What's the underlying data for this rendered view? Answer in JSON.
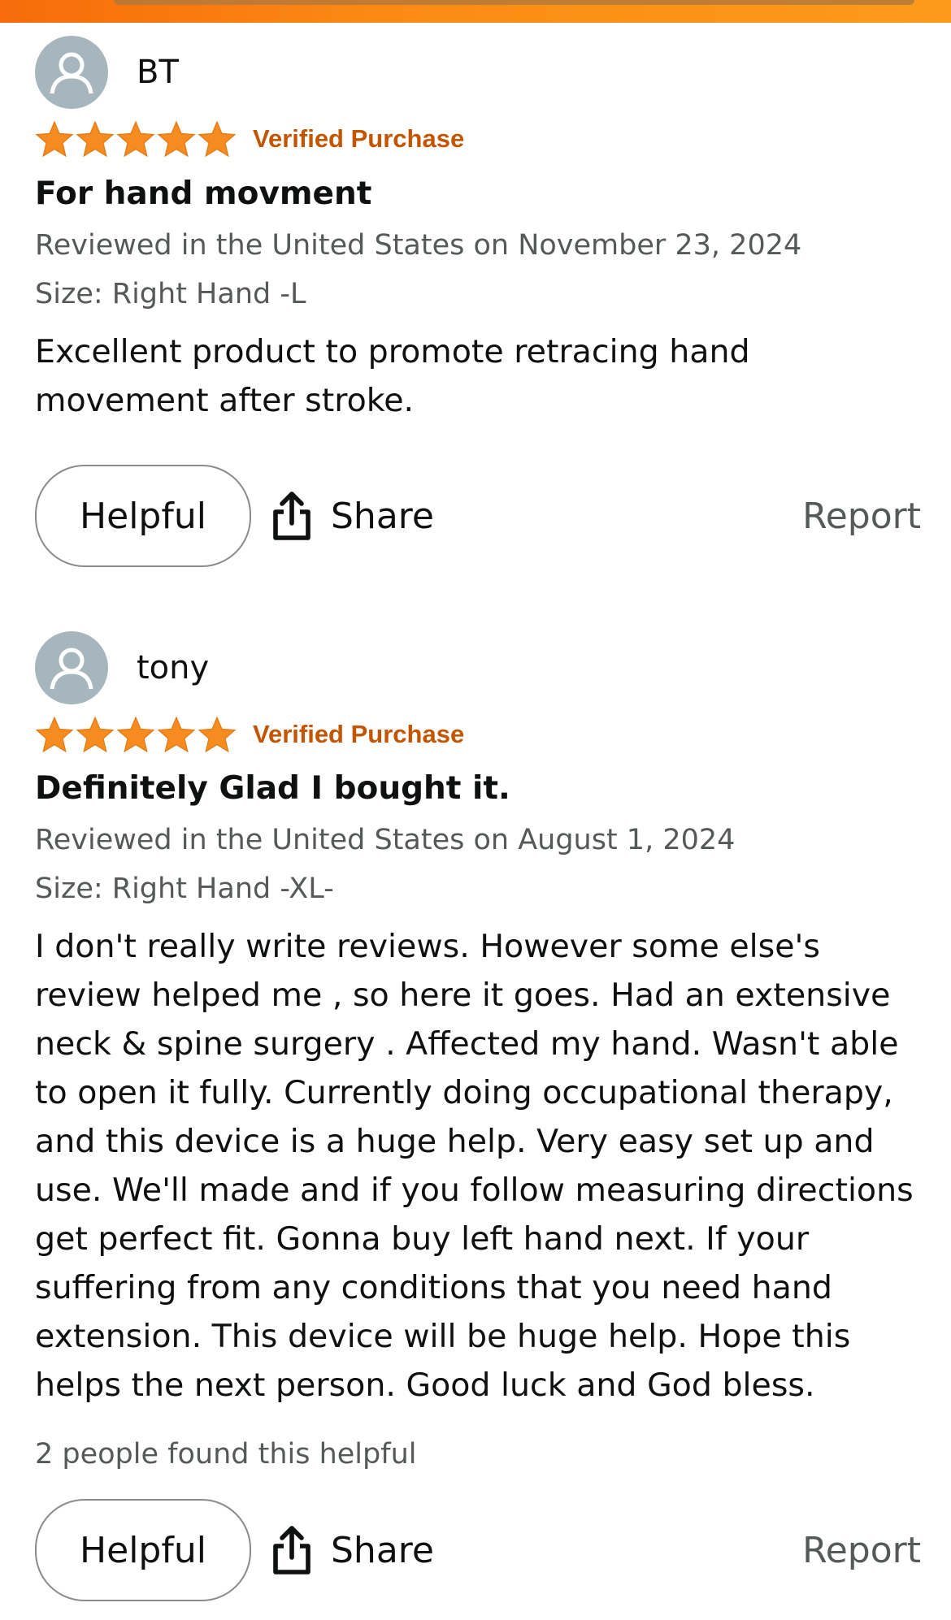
{
  "colors": {
    "accent_orange": "#f7801a",
    "star": "#f68b1f",
    "verified": "#c45500",
    "muted_text": "#565959",
    "avatar_bg": "#a7b6bc"
  },
  "reviews": [
    {
      "author": "BT",
      "rating": 5,
      "verified_label": "Verified Purchase",
      "title": "For hand movment",
      "reviewed_in": "Reviewed in the United States on November 23, 2024",
      "size": "Size: Right Hand -L",
      "body": "Excellent product to promote retracing hand movement after stroke.",
      "helpful_label": "Helpful",
      "share_label": "Share",
      "report_label": "Report"
    },
    {
      "author": "tony",
      "rating": 5,
      "verified_label": "Verified Purchase",
      "title": "Definitely Glad I bought it.",
      "reviewed_in": "Reviewed in the United States on August 1, 2024",
      "size": "Size: Right Hand -XL-",
      "body": "I don't really write reviews. However some else's review helped me , so here it goes. Had an extensive neck & spine surgery . Affected my hand. Wasn't able to open it fully. Currently doing occupational therapy, and this device is a huge help. Very easy set up and use. We'll made and if you follow measuring directions get perfect fit. Gonna buy left hand next. If your suffering from any conditions that you need hand extension. This device will be huge help. Hope this helps the next person. Good luck and God bless.",
      "helpful_count_text": "2 people found this helpful",
      "helpful_label": "Helpful",
      "share_label": "Share",
      "report_label": "Report"
    }
  ]
}
